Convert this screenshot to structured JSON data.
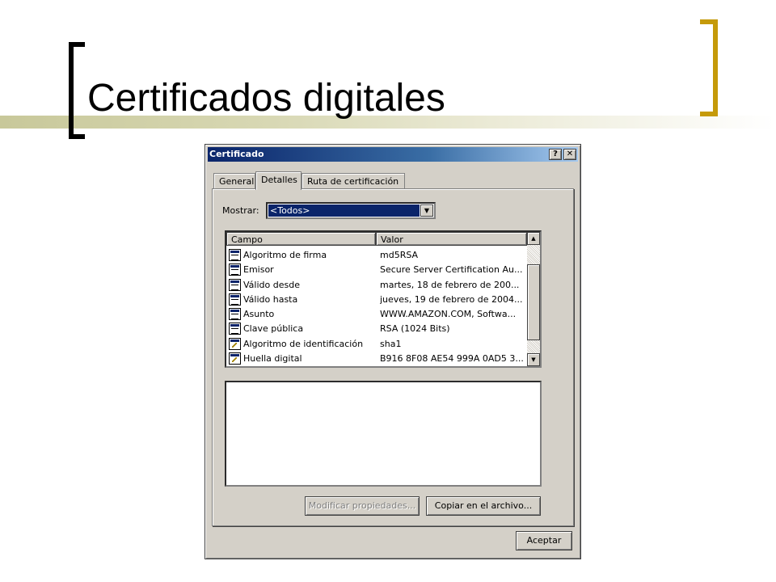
{
  "slide": {
    "title": "Certificados digitales"
  },
  "dialog": {
    "title": "Certificado",
    "help_glyph": "?",
    "close_glyph": "✕",
    "tabs": [
      {
        "label": "General"
      },
      {
        "label": "Detalles"
      },
      {
        "label": "Ruta de certificación"
      }
    ],
    "active_tab": "Detalles",
    "show_label": "Mostrar:",
    "show_value": "<Todos>",
    "list": {
      "columns": [
        "Campo",
        "Valor"
      ],
      "rows": [
        {
          "campo": "Algoritmo de firma",
          "valor": "md5RSA",
          "icon": "certificate-field-icon"
        },
        {
          "campo": "Emisor",
          "valor": "Secure Server Certification Au...",
          "icon": "certificate-field-icon"
        },
        {
          "campo": "Válido desde",
          "valor": "martes, 18 de febrero de 200...",
          "icon": "certificate-field-icon"
        },
        {
          "campo": "Válido hasta",
          "valor": "jueves, 19 de febrero de 2004...",
          "icon": "certificate-field-icon"
        },
        {
          "campo": "Asunto",
          "valor": "WWW.AMAZON.COM, Softwa...",
          "icon": "certificate-field-icon"
        },
        {
          "campo": "Clave pública",
          "valor": "RSA (1024 Bits)",
          "icon": "certificate-field-icon"
        },
        {
          "campo": "Algoritmo de identificación",
          "valor": "sha1",
          "icon": "certificate-extension-icon"
        },
        {
          "campo": "Huella digital",
          "valor": "B916 8F08 AE54 999A 0AD5 3...",
          "icon": "certificate-extension-icon"
        }
      ]
    },
    "buttons": {
      "modify": "Modificar propiedades...",
      "copy": "Copiar en el archivo...",
      "accept": "Aceptar"
    },
    "colors": {
      "titlebar_start": "#0a246a",
      "titlebar_end": "#a6caf0",
      "selection": "#0a246a",
      "face": "#d4d0c8"
    }
  }
}
